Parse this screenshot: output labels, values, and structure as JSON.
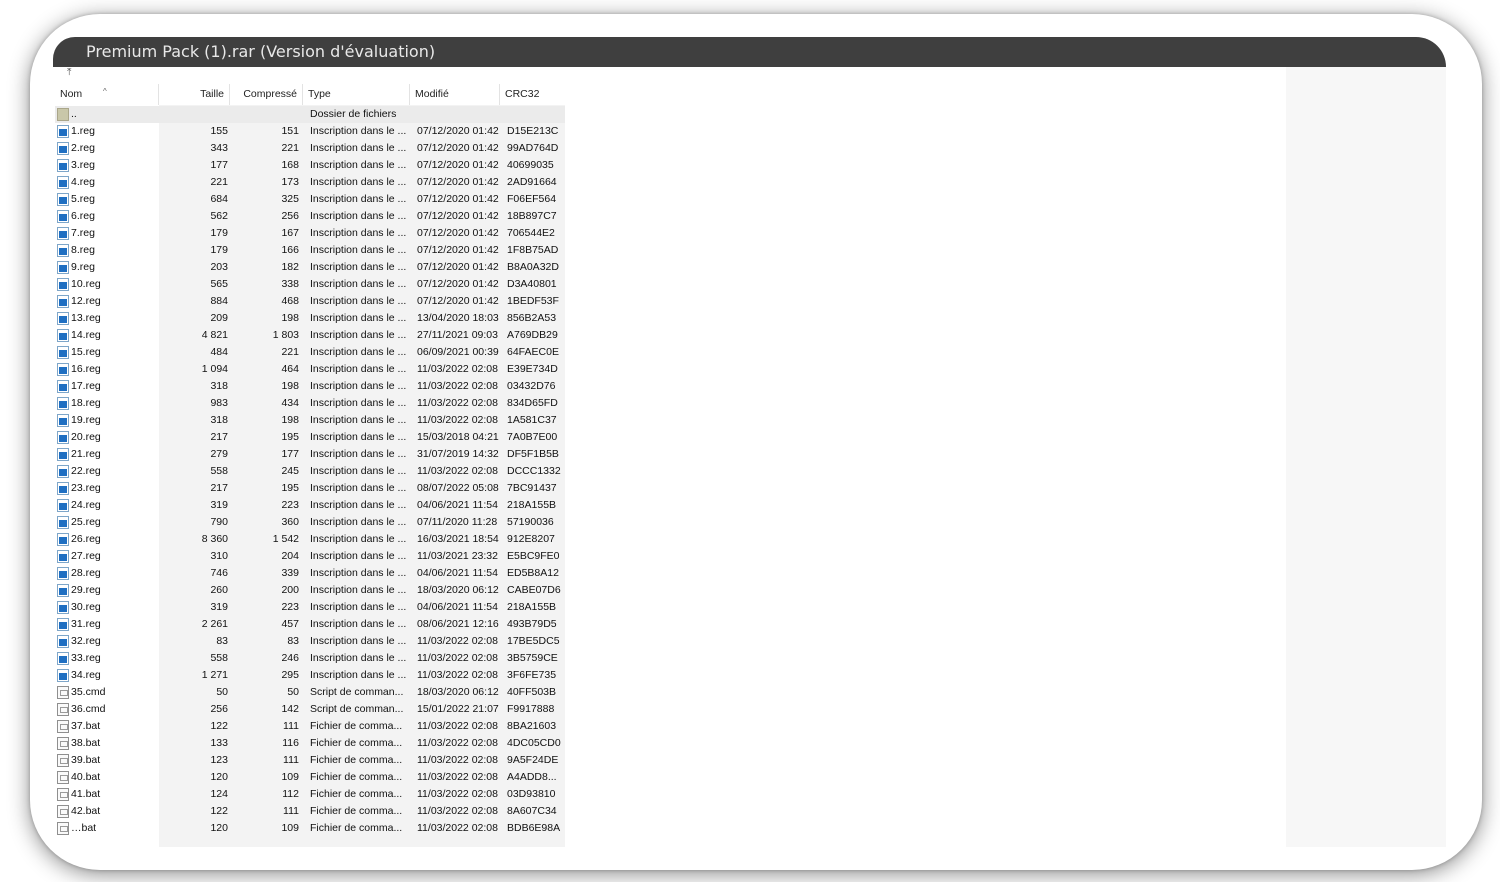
{
  "window": {
    "title": "Premium Pack (1).rar (Version d'évaluation)"
  },
  "toolbar": {
    "up_icon": "up-arrow-icon",
    "sort_icon": "sort-ascending-icon"
  },
  "columns": {
    "name": "Nom",
    "size": "Taille",
    "compressed": "Compressé",
    "type": "Type",
    "modified": "Modifié",
    "crc": "CRC32"
  },
  "parent_row": {
    "name": "..",
    "type": "Dossier de fichiers"
  },
  "files": [
    {
      "name": "1.reg",
      "size": "155",
      "compressed": "151",
      "type": "Inscription dans le ...",
      "modified": "07/12/2020 01:42",
      "crc": "D15E213C",
      "icon": "reg"
    },
    {
      "name": "2.reg",
      "size": "343",
      "compressed": "221",
      "type": "Inscription dans le ...",
      "modified": "07/12/2020 01:42",
      "crc": "99AD764D",
      "icon": "reg"
    },
    {
      "name": "3.reg",
      "size": "177",
      "compressed": "168",
      "type": "Inscription dans le ...",
      "modified": "07/12/2020 01:42",
      "crc": "40699035",
      "icon": "reg"
    },
    {
      "name": "4.reg",
      "size": "221",
      "compressed": "173",
      "type": "Inscription dans le ...",
      "modified": "07/12/2020 01:42",
      "crc": "2AD91664",
      "icon": "reg"
    },
    {
      "name": "5.reg",
      "size": "684",
      "compressed": "325",
      "type": "Inscription dans le ...",
      "modified": "07/12/2020 01:42",
      "crc": "F06EF564",
      "icon": "reg"
    },
    {
      "name": "6.reg",
      "size": "562",
      "compressed": "256",
      "type": "Inscription dans le ...",
      "modified": "07/12/2020 01:42",
      "crc": "18B897C7",
      "icon": "reg"
    },
    {
      "name": "7.reg",
      "size": "179",
      "compressed": "167",
      "type": "Inscription dans le ...",
      "modified": "07/12/2020 01:42",
      "crc": "706544E2",
      "icon": "reg"
    },
    {
      "name": "8.reg",
      "size": "179",
      "compressed": "166",
      "type": "Inscription dans le ...",
      "modified": "07/12/2020 01:42",
      "crc": "1F8B75AD",
      "icon": "reg"
    },
    {
      "name": "9.reg",
      "size": "203",
      "compressed": "182",
      "type": "Inscription dans le ...",
      "modified": "07/12/2020 01:42",
      "crc": "B8A0A32D",
      "icon": "reg"
    },
    {
      "name": "10.reg",
      "size": "565",
      "compressed": "338",
      "type": "Inscription dans le ...",
      "modified": "07/12/2020 01:42",
      "crc": "D3A40801",
      "icon": "reg"
    },
    {
      "name": "12.reg",
      "size": "884",
      "compressed": "468",
      "type": "Inscription dans le ...",
      "modified": "07/12/2020 01:42",
      "crc": "1BEDF53F",
      "icon": "reg"
    },
    {
      "name": "13.reg",
      "size": "209",
      "compressed": "198",
      "type": "Inscription dans le ...",
      "modified": "13/04/2020 18:03",
      "crc": "856B2A53",
      "icon": "reg"
    },
    {
      "name": "14.reg",
      "size": "4 821",
      "compressed": "1 803",
      "type": "Inscription dans le ...",
      "modified": "27/11/2021 09:03",
      "crc": "A769DB29",
      "icon": "reg"
    },
    {
      "name": "15.reg",
      "size": "484",
      "compressed": "221",
      "type": "Inscription dans le ...",
      "modified": "06/09/2021 00:39",
      "crc": "64FAEC0E",
      "icon": "reg"
    },
    {
      "name": "16.reg",
      "size": "1 094",
      "compressed": "464",
      "type": "Inscription dans le ...",
      "modified": "11/03/2022 02:08",
      "crc": "E39E734D",
      "icon": "reg"
    },
    {
      "name": "17.reg",
      "size": "318",
      "compressed": "198",
      "type": "Inscription dans le ...",
      "modified": "11/03/2022 02:08",
      "crc": "03432D76",
      "icon": "reg"
    },
    {
      "name": "18.reg",
      "size": "983",
      "compressed": "434",
      "type": "Inscription dans le ...",
      "modified": "11/03/2022 02:08",
      "crc": "834D65FD",
      "icon": "reg"
    },
    {
      "name": "19.reg",
      "size": "318",
      "compressed": "198",
      "type": "Inscription dans le ...",
      "modified": "11/03/2022 02:08",
      "crc": "1A581C37",
      "icon": "reg"
    },
    {
      "name": "20.reg",
      "size": "217",
      "compressed": "195",
      "type": "Inscription dans le ...",
      "modified": "15/03/2018 04:21",
      "crc": "7A0B7E00",
      "icon": "reg"
    },
    {
      "name": "21.reg",
      "size": "279",
      "compressed": "177",
      "type": "Inscription dans le ...",
      "modified": "31/07/2019 14:32",
      "crc": "DF5F1B5B",
      "icon": "reg"
    },
    {
      "name": "22.reg",
      "size": "558",
      "compressed": "245",
      "type": "Inscription dans le ...",
      "modified": "11/03/2022 02:08",
      "crc": "DCCC1332",
      "icon": "reg"
    },
    {
      "name": "23.reg",
      "size": "217",
      "compressed": "195",
      "type": "Inscription dans le ...",
      "modified": "08/07/2022 05:08",
      "crc": "7BC91437",
      "icon": "reg"
    },
    {
      "name": "24.reg",
      "size": "319",
      "compressed": "223",
      "type": "Inscription dans le ...",
      "modified": "04/06/2021 11:54",
      "crc": "218A155B",
      "icon": "reg"
    },
    {
      "name": "25.reg",
      "size": "790",
      "compressed": "360",
      "type": "Inscription dans le ...",
      "modified": "07/11/2020 11:28",
      "crc": "57190036",
      "icon": "reg"
    },
    {
      "name": "26.reg",
      "size": "8 360",
      "compressed": "1 542",
      "type": "Inscription dans le ...",
      "modified": "16/03/2021 18:54",
      "crc": "912E8207",
      "icon": "reg"
    },
    {
      "name": "27.reg",
      "size": "310",
      "compressed": "204",
      "type": "Inscription dans le ...",
      "modified": "11/03/2021 23:32",
      "crc": "E5BC9FE0",
      "icon": "reg"
    },
    {
      "name": "28.reg",
      "size": "746",
      "compressed": "339",
      "type": "Inscription dans le ...",
      "modified": "04/06/2021 11:54",
      "crc": "ED5B8A12",
      "icon": "reg"
    },
    {
      "name": "29.reg",
      "size": "260",
      "compressed": "200",
      "type": "Inscription dans le ...",
      "modified": "18/03/2020 06:12",
      "crc": "CABE07D6",
      "icon": "reg"
    },
    {
      "name": "30.reg",
      "size": "319",
      "compressed": "223",
      "type": "Inscription dans le ...",
      "modified": "04/06/2021 11:54",
      "crc": "218A155B",
      "icon": "reg"
    },
    {
      "name": "31.reg",
      "size": "2 261",
      "compressed": "457",
      "type": "Inscription dans le ...",
      "modified": "08/06/2021 12:16",
      "crc": "493B79D5",
      "icon": "reg"
    },
    {
      "name": "32.reg",
      "size": "83",
      "compressed": "83",
      "type": "Inscription dans le ...",
      "modified": "11/03/2022 02:08",
      "crc": "17BE5DC5",
      "icon": "reg"
    },
    {
      "name": "33.reg",
      "size": "558",
      "compressed": "246",
      "type": "Inscription dans le ...",
      "modified": "11/03/2022 02:08",
      "crc": "3B5759CE",
      "icon": "reg"
    },
    {
      "name": "34.reg",
      "size": "1 271",
      "compressed": "295",
      "type": "Inscription dans le ...",
      "modified": "11/03/2022 02:08",
      "crc": "3F6FE735",
      "icon": "reg"
    },
    {
      "name": "35.cmd",
      "size": "50",
      "compressed": "50",
      "type": "Script de comman...",
      "modified": "18/03/2020 06:12",
      "crc": "40FF503B",
      "icon": "script"
    },
    {
      "name": "36.cmd",
      "size": "256",
      "compressed": "142",
      "type": "Script de comman...",
      "modified": "15/01/2022 21:07",
      "crc": "F9917888",
      "icon": "script"
    },
    {
      "name": "37.bat",
      "size": "122",
      "compressed": "111",
      "type": "Fichier de comma...",
      "modified": "11/03/2022 02:08",
      "crc": "8BA21603",
      "icon": "script"
    },
    {
      "name": "38.bat",
      "size": "133",
      "compressed": "116",
      "type": "Fichier de comma...",
      "modified": "11/03/2022 02:08",
      "crc": "4DC05CD0",
      "icon": "script"
    },
    {
      "name": "39.bat",
      "size": "123",
      "compressed": "111",
      "type": "Fichier de comma...",
      "modified": "11/03/2022 02:08",
      "crc": "9A5F24DE",
      "icon": "script"
    },
    {
      "name": "40.bat",
      "size": "120",
      "compressed": "109",
      "type": "Fichier de comma...",
      "modified": "11/03/2022 02:08",
      "crc": "A4ADD8...",
      "icon": "script"
    },
    {
      "name": "41.bat",
      "size": "124",
      "compressed": "112",
      "type": "Fichier de comma...",
      "modified": "11/03/2022 02:08",
      "crc": "03D93810",
      "icon": "script"
    },
    {
      "name": "42.bat",
      "size": "122",
      "compressed": "111",
      "type": "Fichier de comma...",
      "modified": "11/03/2022 02:08",
      "crc": "8A607C34",
      "icon": "script"
    },
    {
      "name": "…bat",
      "size": "120",
      "compressed": "109",
      "type": "Fichier de comma...",
      "modified": "11/03/2022 02:08",
      "crc": "BDB6E98A",
      "icon": "script"
    }
  ]
}
